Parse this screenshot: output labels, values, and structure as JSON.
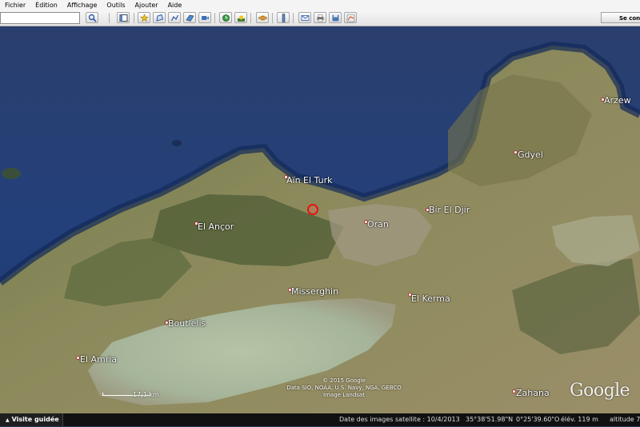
{
  "menu": {
    "items": [
      "Fichier",
      "Édition",
      "Affichage",
      "Outils",
      "Ajouter",
      "Aide"
    ]
  },
  "toolbar": {
    "search_value": "",
    "signin_label": "Se conn",
    "buttons": [
      {
        "name": "search-icon"
      },
      {
        "name": "sidebar-toggle-icon"
      },
      {
        "name": "placemark-icon"
      },
      {
        "name": "polygon-icon"
      },
      {
        "name": "path-icon"
      },
      {
        "name": "image-overlay-icon"
      },
      {
        "name": "record-tour-icon"
      },
      {
        "name": "historical-imagery-icon"
      },
      {
        "name": "sunlight-icon"
      },
      {
        "name": "planet-icon"
      },
      {
        "name": "ruler-icon"
      },
      {
        "name": "email-icon"
      },
      {
        "name": "print-icon"
      },
      {
        "name": "save-image-icon"
      },
      {
        "name": "maps-icon"
      }
    ]
  },
  "map": {
    "places": [
      {
        "name": "Arzew",
        "slug": "arzew"
      },
      {
        "name": "Gdyel",
        "slug": "gdyel"
      },
      {
        "name": "Aïn El Turk",
        "slug": "ain-el-turk"
      },
      {
        "name": "Bir El Djir",
        "slug": "bir-el-djir"
      },
      {
        "name": "Oran",
        "slug": "oran"
      },
      {
        "name": "El Ançor",
        "slug": "el-ancor"
      },
      {
        "name": "Misserghin",
        "slug": "misserghin"
      },
      {
        "name": "El Kerma",
        "slug": "el-kerma"
      },
      {
        "name": "Boutlélis",
        "slug": "boutlelis"
      },
      {
        "name": "El Amria",
        "slug": "el-amria"
      },
      {
        "name": "Zahana",
        "slug": "zahana"
      }
    ],
    "copyright_line1": "© 2015 Google",
    "copyright_line2": "Data SIO, NOAA, U.S. Navy, NGA, GEBCO",
    "copyright_line3": "Image Landsat",
    "scale_label": "17,1 km",
    "logo": "Google"
  },
  "status": {
    "tour_label": "Visite guidée",
    "imagery_date": "Date des images satellite : 10/4/2013",
    "latitude": "35°38'51.98\"N",
    "longitude": "0°25'39.60\"O",
    "elevation": "élév. 119 m",
    "altitude": "altitude 7"
  },
  "colors": {
    "sea": "#24407a",
    "land": "#8c8a5c",
    "sebkha": "#a6b59a",
    "marker": "#e11111"
  }
}
